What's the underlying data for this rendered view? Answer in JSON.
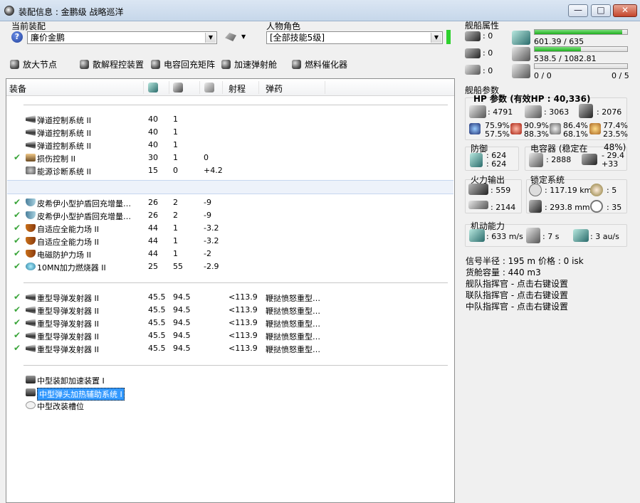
{
  "window": {
    "title": "装配信息 : 金鹏级 战略巡洋",
    "minimize": "—",
    "maximize": "□",
    "close": "✕"
  },
  "fitting": {
    "label": "当前装配",
    "value": "廉价金鹏"
  },
  "character": {
    "label": "人物角色",
    "value": "[全部技能5级]"
  },
  "toolbar": [
    {
      "label": "放大节点",
      "icon": "amplifier-icon"
    },
    {
      "label": "散解程控装置",
      "icon": "capacitor-icon"
    },
    {
      "label": "电容回充矩阵",
      "icon": "cap-recharge-icon"
    },
    {
      "label": "加速弹射舱",
      "icon": "accelerator-icon"
    },
    {
      "label": "燃料催化器",
      "icon": "fuel-icon"
    }
  ],
  "list": {
    "headers": {
      "name": "装备",
      "range": "射程",
      "ammo": "弹药"
    },
    "subsystems": [
      {
        "check": "",
        "name": "弹道控制系统 II",
        "cpu": "40",
        "pg": "1",
        "cap": ""
      },
      {
        "check": "",
        "name": "弹道控制系统 II",
        "cpu": "40",
        "pg": "1",
        "cap": ""
      },
      {
        "check": "",
        "name": "弹道控制系统 II",
        "cpu": "40",
        "pg": "1",
        "cap": ""
      },
      {
        "check": "✔",
        "name": "损伤控制 II",
        "cpu": "30",
        "pg": "1",
        "cap": "0"
      },
      {
        "check": "",
        "name": "能源诊断系统 II",
        "cpu": "15",
        "pg": "0",
        "cap": "+4.2"
      }
    ],
    "mid": [
      {
        "check": "✔",
        "name": "皮希伊小型护盾回充增量…",
        "cpu": "26",
        "pg": "2",
        "cap": "-9"
      },
      {
        "check": "✔",
        "name": "皮希伊小型护盾回充增量…",
        "cpu": "26",
        "pg": "2",
        "cap": "-9"
      },
      {
        "check": "✔",
        "name": "自适应全能力场 II",
        "cpu": "44",
        "pg": "1",
        "cap": "-3.2"
      },
      {
        "check": "✔",
        "name": "自适应全能力场 II",
        "cpu": "44",
        "pg": "1",
        "cap": "-3.2"
      },
      {
        "check": "✔",
        "name": "电磁防护力场 II",
        "cpu": "44",
        "pg": "1",
        "cap": "-2"
      },
      {
        "check": "✔",
        "name": "10MN加力燃烧器 II",
        "cpu": "25",
        "pg": "55",
        "cap": "-2.9"
      }
    ],
    "high": [
      {
        "check": "✔",
        "name": "重型导弹发射器 II",
        "cpu": "45.5",
        "pg": "94.5",
        "range": "<113.9",
        "ammo": "鞭挞愤怒重型…"
      },
      {
        "check": "✔",
        "name": "重型导弹发射器 II",
        "cpu": "45.5",
        "pg": "94.5",
        "range": "<113.9",
        "ammo": "鞭挞愤怒重型…"
      },
      {
        "check": "✔",
        "name": "重型导弹发射器 II",
        "cpu": "45.5",
        "pg": "94.5",
        "range": "<113.9",
        "ammo": "鞭挞愤怒重型…"
      },
      {
        "check": "✔",
        "name": "重型导弹发射器 II",
        "cpu": "45.5",
        "pg": "94.5",
        "range": "<113.9",
        "ammo": "鞭挞愤怒重型…"
      },
      {
        "check": "✔",
        "name": "重型导弹发射器 II",
        "cpu": "45.5",
        "pg": "94.5",
        "range": "<113.9",
        "ammo": "鞭挞愤怒重型…"
      }
    ],
    "rigs": [
      {
        "name": "中型装卸加速装置 I"
      },
      {
        "name": "中型弹头加热辅助系统 I"
      },
      {
        "name": "中型改装槽位"
      }
    ]
  },
  "ship_attributes": {
    "label": "舰船属性",
    "hardpoints": [
      "0",
      "0",
      "0"
    ],
    "cpu": {
      "text": "601.39 / 635",
      "fraction": 0.947
    },
    "powergrid": {
      "text": "538.5 / 1082.81",
      "fraction": 0.497
    },
    "calibration": {
      "text": "0 / 0",
      "right": "0 / 5",
      "fraction": 0
    }
  },
  "ship_params": {
    "label": "舰船参数",
    "hp_title": "HP 参数 (有效HP : 40,336)",
    "shield": ": 4791",
    "armor": ": 3063",
    "structure": ": 2076",
    "resists": [
      [
        "75.9%",
        "57.5%"
      ],
      [
        "90.9%",
        "88.3%"
      ],
      [
        "86.4%",
        "68.1%"
      ],
      [
        "77.4%",
        "23.5%"
      ]
    ],
    "defense": {
      "label": "防御",
      "a": ": 624",
      "b": ": 624"
    },
    "capacitor": {
      "label": "电容器 (稳定在",
      "pct": "48%)",
      "amount": ": 2888",
      "delta_a": "- 29.4",
      "delta_b": "+33"
    },
    "firepower": {
      "label": "火力输出",
      "dps": ": 559",
      "volley": ": 2144"
    },
    "targeting": {
      "label": "锁定系统",
      "range": ": 117.19 km",
      "targets": ": 5",
      "scan": ": 293.8 mm",
      "sensor": ": 35"
    },
    "mobility": {
      "label": "机动能力",
      "speed": ": 633 m/s",
      "align": ": 7 s",
      "warp": ": 3 au/s"
    },
    "signature": "信号半径 : 195 m",
    "price": "价格 : 0 isk",
    "cargo": "货舱容量 : 440 m3",
    "fleet_cmd": "舰队指挥官 - 点击右键设置",
    "wing_cmd": "联队指挥官 - 点击右键设置",
    "squad_cmd": "中队指挥官 - 点击右键设置"
  }
}
